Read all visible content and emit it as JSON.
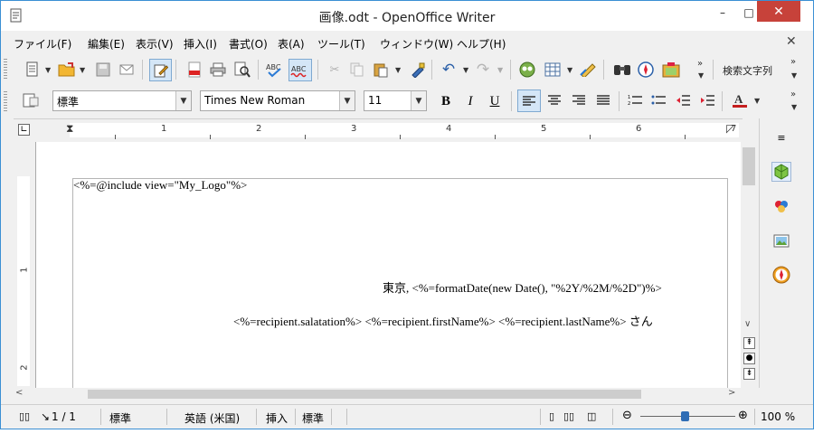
{
  "window": {
    "title": "画像.odt - OpenOffice Writer",
    "minimize_glyph": "–",
    "maximize_glyph": "□",
    "close_glyph": "✕"
  },
  "menu": {
    "items": [
      "ファイル(F)",
      "編集(E)",
      "表示(V)",
      "挿入(I)",
      "書式(O)",
      "表(A)",
      "ツール(T)",
      "ウィンドウ(W)",
      "ヘルプ(H)"
    ],
    "close_doc_glyph": "✕"
  },
  "toolbar": {
    "find_text_label": "検索文字列",
    "more_glyph": "»"
  },
  "formatting": {
    "paragraph_style": "標準",
    "font_name": "Times New Roman",
    "font_size": "11",
    "bold_glyph": "B",
    "italic_glyph": "I",
    "underline_glyph": "U"
  },
  "ruler": {
    "numbers": [
      "1",
      "2",
      "3",
      "4",
      "5",
      "6",
      "7"
    ],
    "vertical_numbers": [
      "1",
      "2"
    ]
  },
  "document": {
    "line1": "<%=@include view=\"My_Logo\"%>",
    "line2": "東京, <%=formatDate(new Date(), \"%2Y/%2M/%2D\")%>",
    "line3": "<%=recipient.salatation%> <%=recipient.firstName%> <%=recipient.lastName%> さん"
  },
  "status": {
    "page": "1 / 1",
    "page_style": "標準",
    "language": "英語 (米国)",
    "insert_mode": "挿入",
    "selection_mode": "標準",
    "zoom": "100 %"
  },
  "colors": {
    "close_button": "#c7423a",
    "window_border": "#3a8fd4",
    "toolbar_bg": "#f0f0f0",
    "zoom_knob": "#2f6db5"
  }
}
